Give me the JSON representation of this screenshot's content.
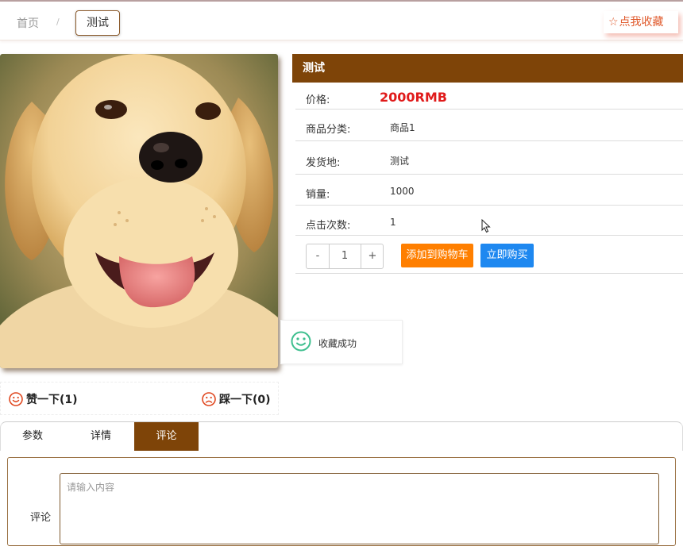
{
  "breadcrumb": {
    "home": "首页",
    "separator": "/",
    "current": "测试"
  },
  "favorite": {
    "label": "点我收藏",
    "icon": "star-outline-icon"
  },
  "product": {
    "title": "测试",
    "price_label": "价格:",
    "price": "2000RMB",
    "fields": [
      {
        "label": "商品分类:",
        "value": "商品1"
      },
      {
        "label": "发货地:",
        "value": "测试"
      },
      {
        "label": "销量:",
        "value": "1000"
      },
      {
        "label": "点击次数:",
        "value": "1"
      }
    ]
  },
  "quantity": {
    "minus": "-",
    "value": "1",
    "plus": "+"
  },
  "actions": {
    "add_to_cart": "添加到购物车",
    "buy_now": "立即购买"
  },
  "toast": {
    "text": "收藏成功",
    "icon": "smile-icon"
  },
  "votes": {
    "like": "赞一下(1)",
    "dislike": "踩一下(0)"
  },
  "tabs": [
    "参数",
    "详情",
    "评论"
  ],
  "active_tab": "评论",
  "comment": {
    "label": "评论",
    "placeholder": "请输入内容"
  },
  "colors": {
    "brand": "#7e4408",
    "price": "#e01a1a",
    "cart": "#ff7f00",
    "buy": "#1e88f0",
    "favorite": "#e05a2c"
  }
}
